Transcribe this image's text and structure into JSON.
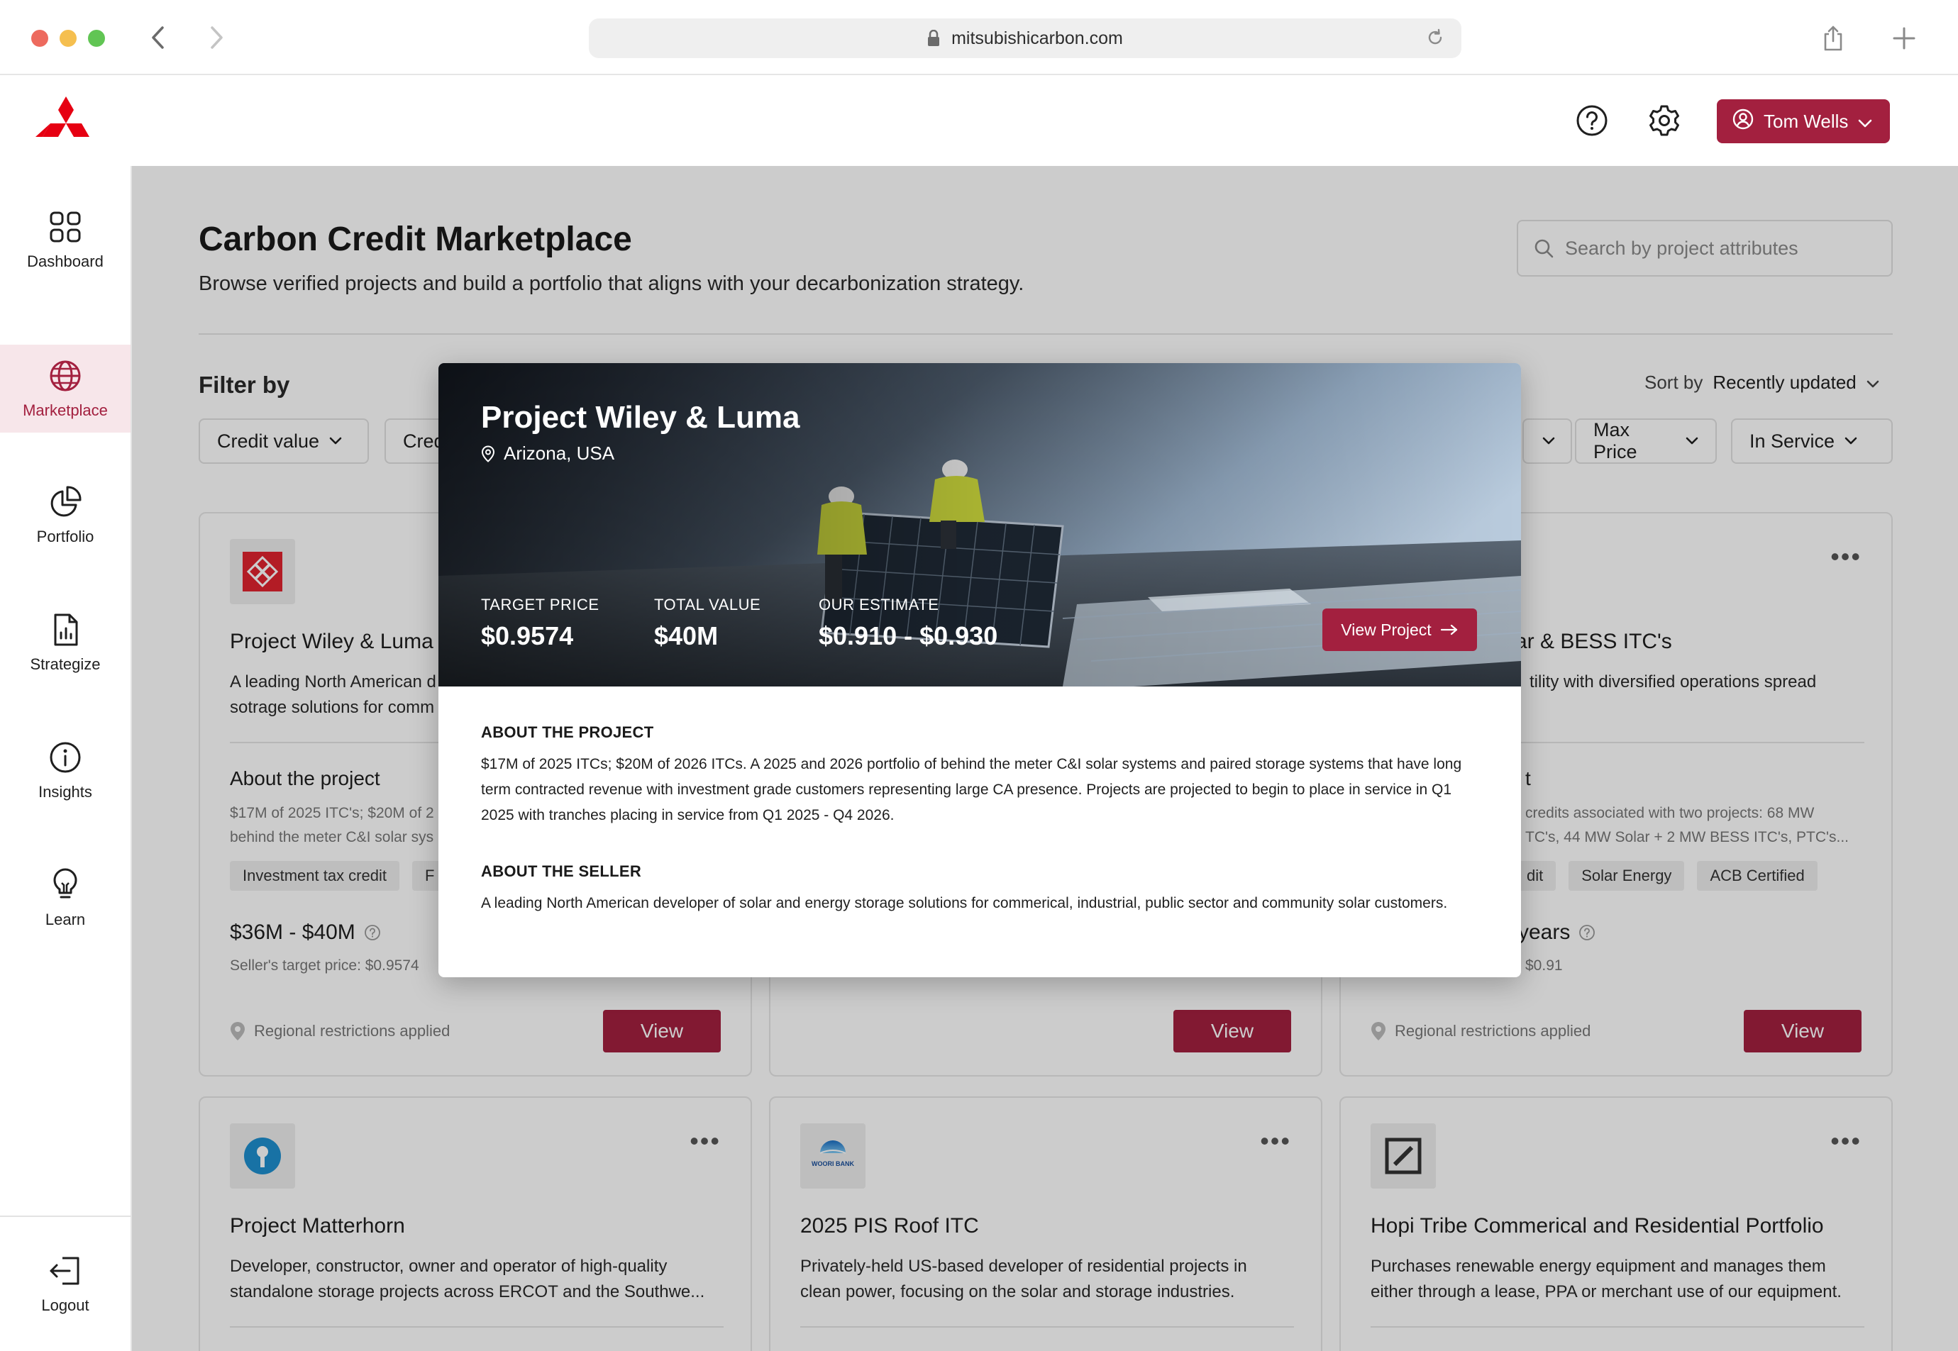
{
  "browser": {
    "url": "mitsubishicarbon.com"
  },
  "header": {
    "user_name": "Tom Wells",
    "brand_color": "#e60012",
    "accent_color": "#a3203f"
  },
  "sidebar": {
    "items": [
      {
        "label": "Dashboard",
        "icon": "grid-icon"
      },
      {
        "label": "Marketplace",
        "icon": "globe-icon",
        "active": true
      },
      {
        "label": "Portfolio",
        "icon": "pie-chart-icon"
      },
      {
        "label": "Strategize",
        "icon": "bar-chart-doc-icon"
      },
      {
        "label": "Insights",
        "icon": "info-icon"
      },
      {
        "label": "Learn",
        "icon": "lightbulb-icon"
      }
    ],
    "logout_label": "Logout"
  },
  "page": {
    "title": "Carbon Credit Marketplace",
    "subtitle": "Browse verified projects and build a portfolio that aligns with your decarbonization strategy.",
    "search_placeholder": "Search by project attributes",
    "filter_label": "Filter by",
    "sort_label": "Sort by",
    "sort_value": "Recently updated",
    "filters": [
      "Credit value",
      "Cred",
      "Max Price",
      "In Service"
    ]
  },
  "cards": [
    {
      "title": "Project Wiley & Luma",
      "desc_line1": "A leading North American d",
      "desc_line2": "sotrage solutions for comm",
      "section": "About the project",
      "section_line1": "$17M of 2025 ITC's; $20M of 2",
      "section_line2": "behind the meter C&I solar sys",
      "tags": [
        "Investment tax credit",
        "F"
      ],
      "price": "$36M - $40M",
      "target": "Seller's target price: $0.9574",
      "restriction": "Regional restrictions applied",
      "view_label": "View"
    },
    {
      "view_label": "View"
    },
    {
      "title": "ar & BESS ITC's",
      "desc_line1": "tility with diversified operations spread",
      "section": "t",
      "section_line1": "credits associated with two projects: 68 MW",
      "section_line2": "TC's, 44 MW Solar + 2 MW BESS ITC's, PTC's...",
      "tags": [
        "dit",
        "Solar Energy",
        "ACB Certified"
      ],
      "price": "years",
      "target": "$0.91",
      "restriction": "Regional restrictions applied",
      "view_label": "View"
    },
    {
      "title": "Project Matterhorn",
      "desc_line1": "Developer, constructor, owner and operator of high-quality",
      "desc_line2": "standalone storage projects across ERCOT and the Southwe..."
    },
    {
      "title": "2025 PIS Roof ITC",
      "desc_line1": "Privately-held US-based developer of residential projects in",
      "desc_line2": "clean power, focusing on the solar and storage industries.",
      "logo_text": "WOORI BANK"
    },
    {
      "title": "Hopi Tribe Commerical and Residential Portfolio",
      "desc_line1": "Purchases renewable energy equipment and manages them",
      "desc_line2": "either through a lease, PPA or merchant use of our equipment."
    }
  ],
  "modal": {
    "title": "Project Wiley & Luma",
    "location": "Arizona, USA",
    "stats": [
      {
        "label": "TARGET PRICE",
        "value": "$0.9574"
      },
      {
        "label": "TOTAL VALUE",
        "value": "$40M"
      },
      {
        "label": "OUR ESTIMATE",
        "value": "$0.910 - $0.930"
      }
    ],
    "view_project_label": "View Project",
    "about_project_heading": "ABOUT THE PROJECT",
    "about_project_text": "$17M of 2025 ITCs; $20M of 2026 ITCs. A 2025 and 2026 portfolio of behind the meter C&I solar systems and paired storage systems that have long term contracted revenue with investment grade customers representing large CA presence. Projects are projected to begin to place in service in Q1 2025 with tranches placing in service from Q1 2025 - Q4 2026.",
    "about_seller_heading": "ABOUT THE SELLER",
    "about_seller_text": "A leading North American developer of solar and energy storage solutions for commerical, industrial, public sector and community solar customers."
  }
}
